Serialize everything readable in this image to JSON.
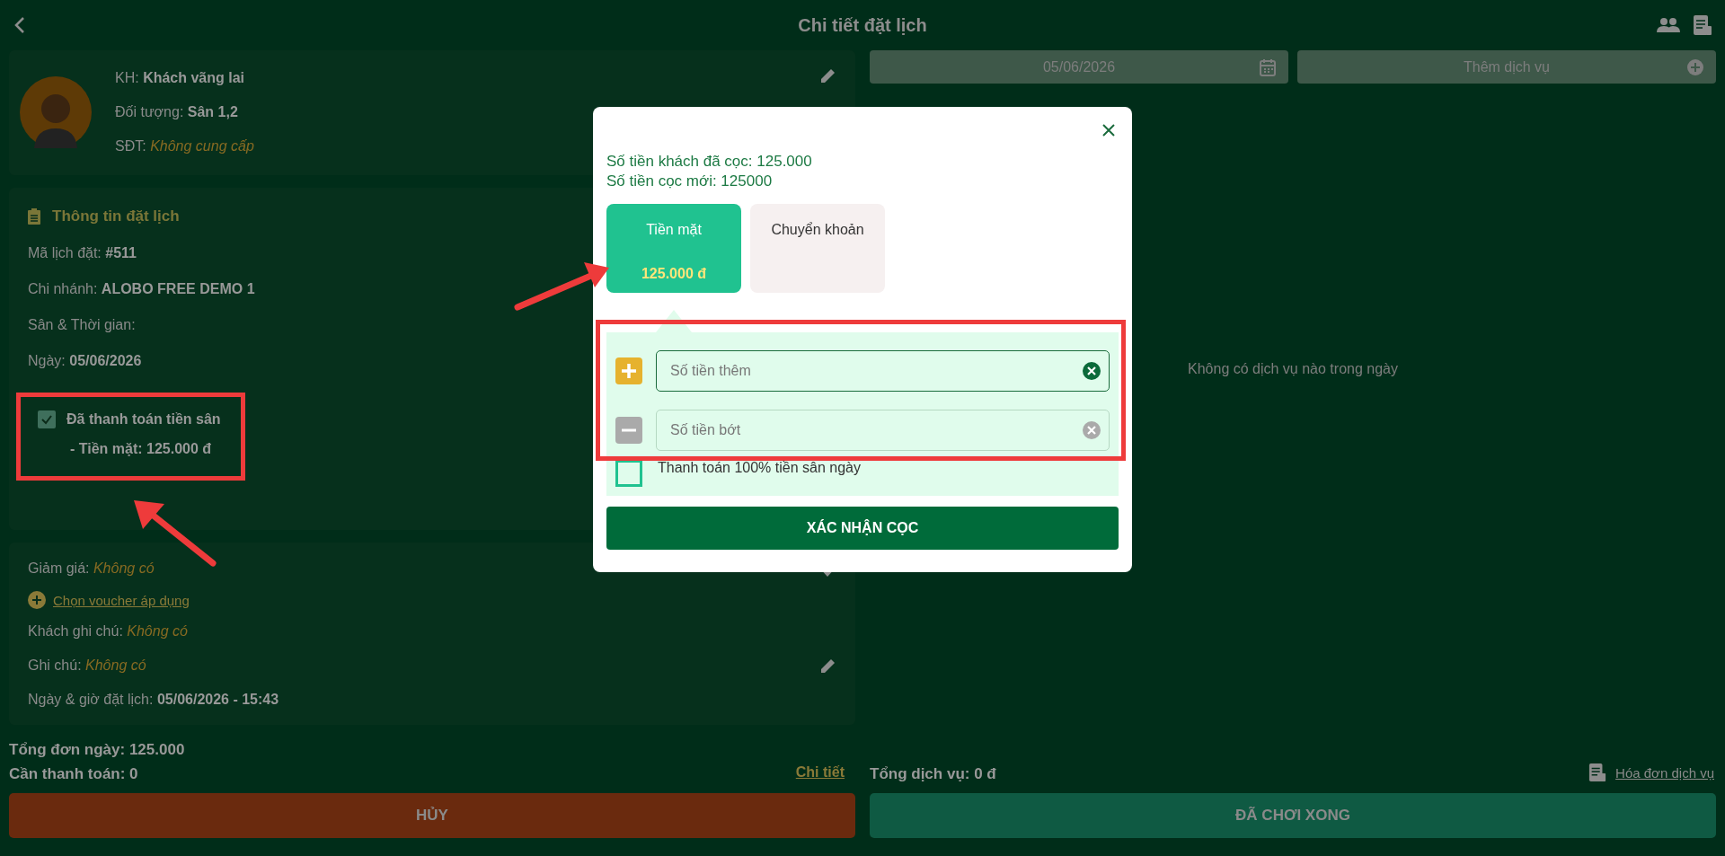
{
  "header": {
    "title": "Chi tiết đặt lịch"
  },
  "customer": {
    "fields": [
      {
        "label": "KH:",
        "value": "Khách vãng lai",
        "kind": "bold"
      },
      {
        "label": "Đối tượng:",
        "value": "Sân 1,2",
        "kind": "bold"
      },
      {
        "label": "SĐT:",
        "value": "Không cung cấp",
        "kind": "italic"
      }
    ]
  },
  "booking_info": {
    "title": "Thông tin đặt lịch",
    "rows": [
      {
        "label": "Mã lịch đặt:",
        "value": "#511"
      },
      {
        "label": "Chi nhánh:",
        "value": "ALOBO FREE DEMO 1"
      },
      {
        "label": "Sân & Thời gian:",
        "value": ""
      },
      {
        "label": "Ngày:",
        "value": "05/06/2026"
      }
    ],
    "payment": {
      "checked": true,
      "label": "Đã thanh toán tiền sân",
      "detail": "- Tiền mặt: 125.000 đ"
    }
  },
  "extras": {
    "discount": {
      "label": "Giảm giá:",
      "value": "Không có"
    },
    "voucher_link": "Chọn voucher áp dụng",
    "rows": [
      {
        "label": "Khách ghi chú:",
        "value": "Không có",
        "kind": "italic"
      },
      {
        "label": "Ghi chú:",
        "value": "Không có",
        "kind": "italic"
      },
      {
        "label": "Ngày & giờ đặt lịch:",
        "value": "05/06/2026 - 15:43",
        "kind": "bold"
      }
    ]
  },
  "totals": {
    "day_total": "Tổng đơn ngày: 125.000",
    "to_pay": "Cần thanh toán: 0",
    "detail_link": "Chi tiết"
  },
  "cancel_button": "HỦY",
  "services": {
    "date": "05/06/2026",
    "add_service": "Thêm dịch vụ",
    "empty": "Không có dịch vụ nào trong ngày",
    "total": "Tổng dịch vụ: 0 đ",
    "invoice_link": "Hóa đơn dịch vụ",
    "done_button": "ĐÃ CHƠI XONG"
  },
  "modal": {
    "deposit_lines": [
      "Số tiền khách đã cọc: 125.000",
      "Số tiền cọc mới: 125000"
    ],
    "methods": [
      {
        "label": "Tiền mặt",
        "amount": "125.000 đ",
        "selected": true
      },
      {
        "label": "Chuyển khoản",
        "selected": false
      }
    ],
    "fields": [
      {
        "kind": "add",
        "placeholder": "Số tiền thêm",
        "active": true
      },
      {
        "kind": "subtract",
        "placeholder": "Số tiền bớt",
        "active": false
      }
    ],
    "full_payment": {
      "label": "Thanh toán 100% tiền sân ngày",
      "checked": false
    },
    "confirm": "XÁC NHẬN CỌC"
  }
}
